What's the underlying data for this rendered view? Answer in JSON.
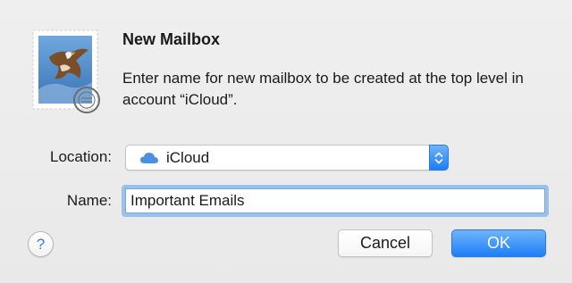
{
  "dialog": {
    "title": "New Mailbox",
    "message": "Enter name for new mailbox to be created at the top level in account “iCloud”."
  },
  "location": {
    "label": "Location:",
    "value": "iCloud",
    "icon": "cloud-icon"
  },
  "name": {
    "label": "Name:",
    "value": "Important Emails"
  },
  "buttons": {
    "help_label": "?",
    "cancel_label": "Cancel",
    "ok_label": "OK"
  },
  "colors": {
    "accent": "#1d7ff6",
    "focus_ring": "#9ac0ee",
    "background": "#ececec"
  }
}
